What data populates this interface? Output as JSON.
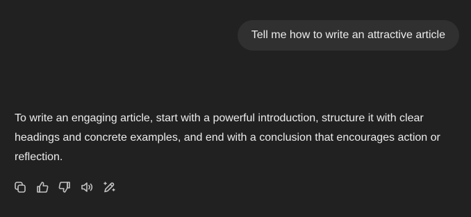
{
  "user_message": {
    "text": "Tell me how to write an attractive article"
  },
  "assistant_message": {
    "text": "To write an engaging article, start with a powerful introduction, structure it with clear headings and concrete examples, and end with a conclusion that encourages action or reflection."
  },
  "message_actions": [
    {
      "icon": "copy-icon"
    },
    {
      "icon": "thumbs-up-icon"
    },
    {
      "icon": "thumbs-down-icon"
    },
    {
      "icon": "read-aloud-icon"
    },
    {
      "icon": "edit-in-canvas-icon"
    }
  ],
  "colors": {
    "background": "#212121",
    "user_bubble": "#303030",
    "text": "#ececec",
    "icon": "#c4c4c4"
  }
}
